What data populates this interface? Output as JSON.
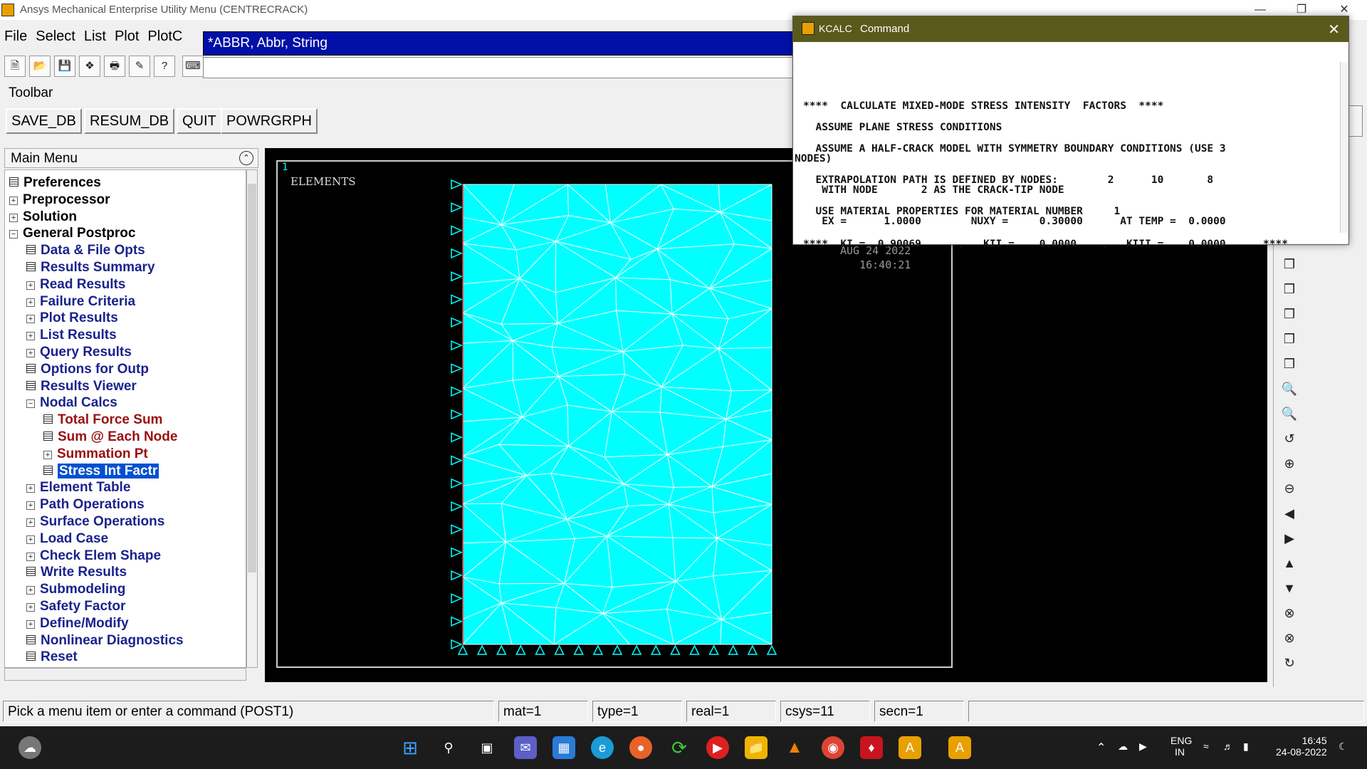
{
  "window": {
    "title": "Ansys Mechanical Enterprise Utility Menu (CENTRECRACK)",
    "minimize_icon": "minimize-icon",
    "maximize_icon": "restore-icon",
    "close_icon": "close-icon"
  },
  "menubar": {
    "items": [
      "File",
      "Select",
      "List",
      "Plot",
      "PlotC"
    ]
  },
  "command_dropdown": {
    "value": "*ABBR, Abbr, String"
  },
  "toolbar": {
    "label": "Toolbar",
    "buttons": [
      "SAVE_DB",
      "RESUM_DB",
      "QUIT",
      "POWRGRPH"
    ]
  },
  "main_menu": {
    "title": "Main Menu",
    "items": [
      {
        "label": "Preferences",
        "type": "doc",
        "level": 0,
        "color": "black"
      },
      {
        "label": "Preprocessor",
        "type": "plus",
        "level": 0,
        "color": "black"
      },
      {
        "label": "Solution",
        "type": "plus",
        "level": 0,
        "color": "black"
      },
      {
        "label": "General Postproc",
        "type": "minus",
        "level": 0,
        "color": "black"
      },
      {
        "label": "Data & File Opts",
        "type": "doc",
        "level": 1,
        "color": "blue"
      },
      {
        "label": "Results Summary",
        "type": "doc",
        "level": 1,
        "color": "blue"
      },
      {
        "label": "Read Results",
        "type": "plus",
        "level": 1,
        "color": "blue"
      },
      {
        "label": "Failure Criteria",
        "type": "plus",
        "level": 1,
        "color": "blue"
      },
      {
        "label": "Plot Results",
        "type": "plus",
        "level": 1,
        "color": "blue"
      },
      {
        "label": "List Results",
        "type": "plus",
        "level": 1,
        "color": "blue"
      },
      {
        "label": "Query Results",
        "type": "plus",
        "level": 1,
        "color": "blue"
      },
      {
        "label": "Options for Outp",
        "type": "doc",
        "level": 1,
        "color": "blue"
      },
      {
        "label": "Results Viewer",
        "type": "doc",
        "level": 1,
        "color": "blue"
      },
      {
        "label": "Nodal Calcs",
        "type": "minus",
        "level": 1,
        "color": "blue"
      },
      {
        "label": "Total Force Sum",
        "type": "doc",
        "level": 2,
        "color": "red"
      },
      {
        "label": "Sum @ Each Node",
        "type": "doc",
        "level": 2,
        "color": "red"
      },
      {
        "label": "Summation Pt",
        "type": "plus",
        "level": 2,
        "color": "red"
      },
      {
        "label": "Stress Int Factr",
        "type": "doc",
        "level": 2,
        "color": "red",
        "selected": true
      },
      {
        "label": "Element Table",
        "type": "plus",
        "level": 1,
        "color": "blue"
      },
      {
        "label": "Path Operations",
        "type": "plus",
        "level": 1,
        "color": "blue"
      },
      {
        "label": "Surface Operations",
        "type": "plus",
        "level": 1,
        "color": "blue"
      },
      {
        "label": "Load Case",
        "type": "plus",
        "level": 1,
        "color": "blue"
      },
      {
        "label": "Check Elem Shape",
        "type": "plus",
        "level": 1,
        "color": "blue"
      },
      {
        "label": "Write Results",
        "type": "doc",
        "level": 1,
        "color": "blue"
      },
      {
        "label": "Submodeling",
        "type": "plus",
        "level": 1,
        "color": "blue"
      },
      {
        "label": "Safety Factor",
        "type": "plus",
        "level": 1,
        "color": "blue"
      },
      {
        "label": "Define/Modify",
        "type": "plus",
        "level": 1,
        "color": "blue"
      },
      {
        "label": "Nonlinear Diagnostics",
        "type": "doc",
        "level": 1,
        "color": "blue"
      },
      {
        "label": "Reset",
        "type": "doc",
        "level": 1,
        "color": "blue"
      }
    ]
  },
  "graphics": {
    "window_number": "1",
    "label": "ELEMENTS",
    "date": "AUG 24 2022",
    "time": "16:40:21",
    "mesh_color": "#00ffff"
  },
  "command_popup": {
    "title_prefix": "KCALC",
    "title": "Command",
    "lines": [
      "****  CALCULATE MIXED-MODE STRESS INTENSITY  FACTORS  ****",
      "  ASSUME PLANE STRESS CONDITIONS",
      "  ASSUME A HALF-CRACK MODEL WITH SYMMETRY BOUNDARY CONDITIONS (USE 3",
      "NODES)",
      "  EXTRAPOLATION PATH IS DEFINED BY NODES:        2      10       8",
      "   WITH NODE       2 AS THE CRACK-TIP NODE",
      "  USE MATERIAL PROPERTIES FOR MATERIAL NUMBER     1",
      "   EX =      1.0000        NUXY =     0.30000      AT TEMP =  0.0000",
      "****  KI =  0.90069      ,   KII =    0.0000    ,   KIII =    0.0000      ****"
    ]
  },
  "statusbar": {
    "prompt": "Pick a menu item or enter a command (POST1)",
    "mat": "mat=1",
    "type": "type=1",
    "real": "real=1",
    "csys": "csys=11",
    "secn": "secn=1"
  },
  "taskbar": {
    "lang": "ENG",
    "region": "IN",
    "time": "16:45",
    "date": "24-08-2022",
    "app_label": "A"
  }
}
